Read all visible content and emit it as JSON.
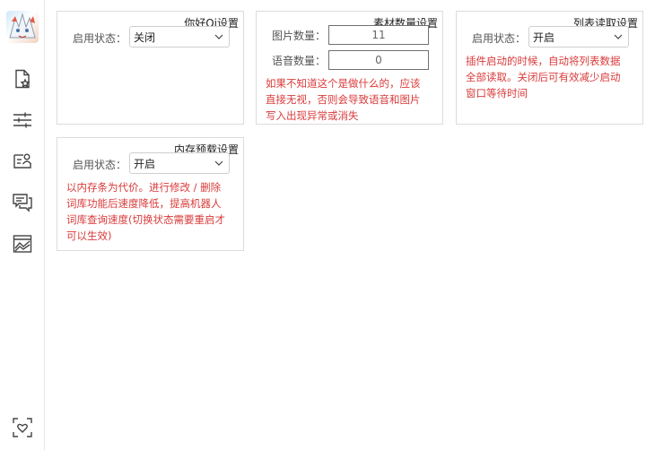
{
  "colors": {
    "warning": "#d93a3a",
    "border": "#dcdcdc",
    "text": "#333333"
  },
  "sidebar": {
    "icons": [
      "avatar",
      "file-star-icon",
      "sliders-icon",
      "user-card-icon",
      "chat-bubbles-icon",
      "chart-image-icon",
      "heart-scan-icon"
    ]
  },
  "panels": {
    "hello_qi": {
      "title": "你好Qi设置",
      "enable_label": "启用状态：",
      "enable_value": "关闭"
    },
    "material_count": {
      "title": "素材数量设置",
      "image_label": "图片数量：",
      "image_value": "11",
      "voice_label": "语音数量：",
      "voice_value": "0",
      "warning_1": "如果不知道这个是做什么的，应该",
      "warning_2": "直接无视，否则会导致语音和图片",
      "warning_3": "写入出现异常或消失"
    },
    "list_read": {
      "title": "列表读取设置",
      "enable_label": "启用状态：",
      "enable_value": "开启",
      "warning_1": "插件启动的时候，自动将列表数据",
      "warning_2": "全部读取。关闭后可有效减少启动",
      "warning_3": "窗口等待时间"
    },
    "memory_preload": {
      "title": "内存预载设置",
      "enable_label": "启用状态：",
      "enable_value": "开启",
      "warning_1": "以内存条为代价。进行修改 / 删除",
      "warning_2": "词库功能后速度降低，提高机器人",
      "warning_3": "词库查询速度(切换状态需要重启才",
      "warning_4": "可以生效)"
    }
  }
}
